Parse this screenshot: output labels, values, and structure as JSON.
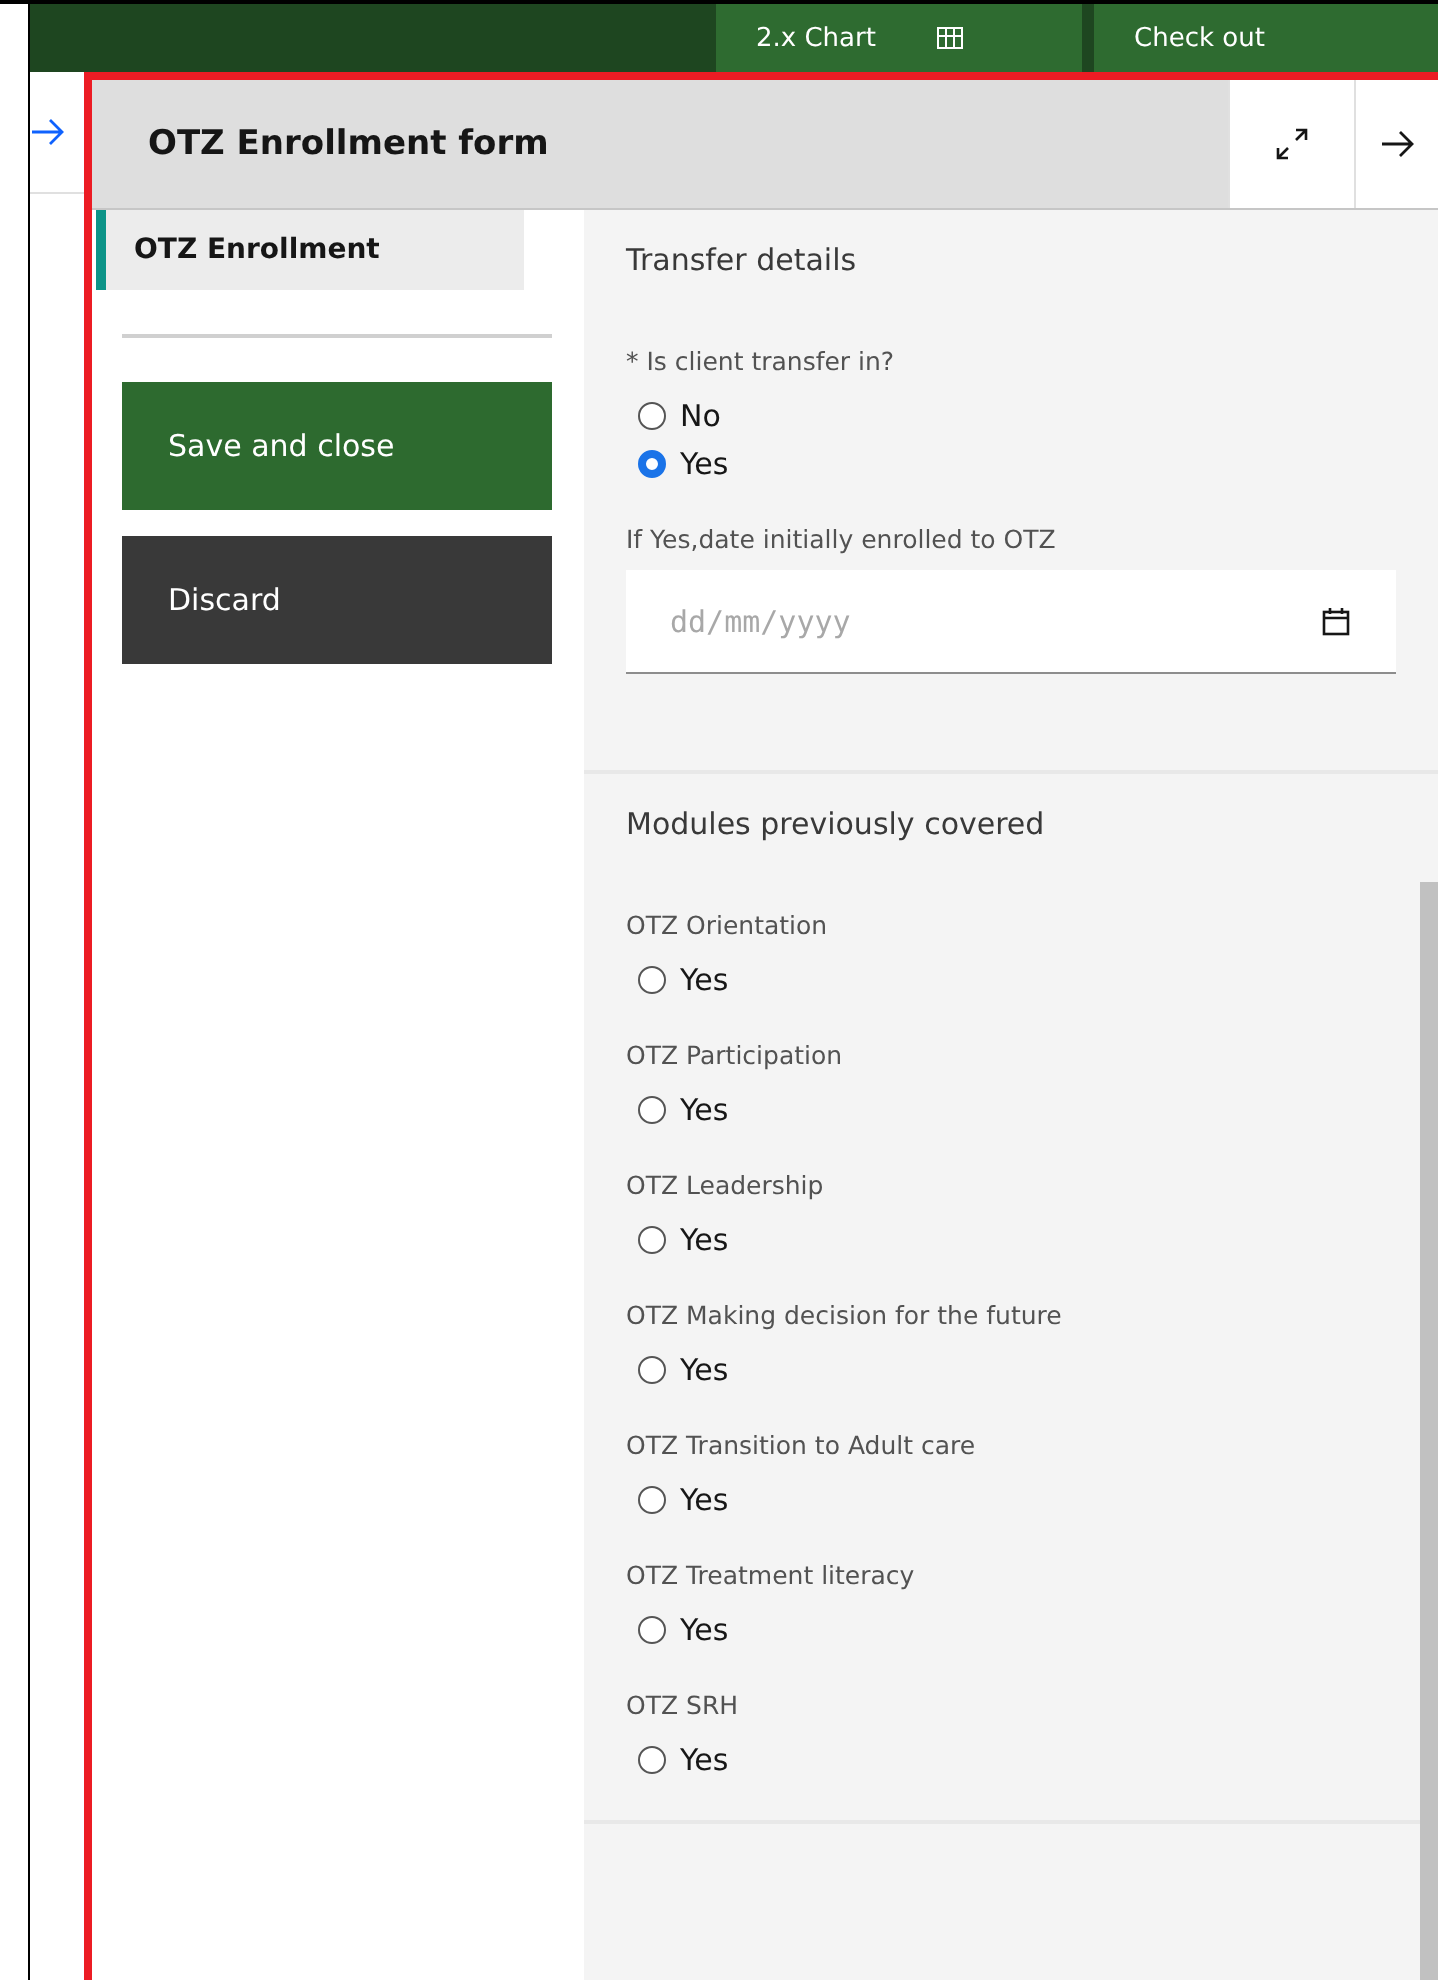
{
  "top_bar": {
    "buttons": [
      "2.x Chart",
      "Check out"
    ]
  },
  "panel": {
    "title": "OTZ Enrollment form"
  },
  "sidebar": {
    "tabs": [
      {
        "label": "OTZ Enrollment",
        "selected": true
      }
    ],
    "buttons": [
      {
        "label": "Save and close",
        "kind": "primary"
      },
      {
        "label": "Discard",
        "kind": "secondary"
      }
    ]
  },
  "sections": [
    {
      "title": "Transfer details",
      "fields": [
        {
          "kind": "radio",
          "label": "* Is client transfer in?",
          "options": [
            {
              "label": "No",
              "selected": false
            },
            {
              "label": "Yes",
              "selected": true
            }
          ]
        },
        {
          "kind": "date",
          "label": "If Yes,date initially enrolled to OTZ",
          "placeholder": "dd/mm/yyyy"
        }
      ]
    },
    {
      "title": "Modules previously covered",
      "fields": [
        {
          "kind": "radio",
          "label": "OTZ Orientation",
          "options": [
            {
              "label": "Yes",
              "selected": false
            }
          ]
        },
        {
          "kind": "radio",
          "label": "OTZ Participation",
          "options": [
            {
              "label": "Yes",
              "selected": false
            }
          ]
        },
        {
          "kind": "radio",
          "label": "OTZ Leadership",
          "options": [
            {
              "label": "Yes",
              "selected": false
            }
          ]
        },
        {
          "kind": "radio",
          "label": "OTZ Making decision for the future",
          "options": [
            {
              "label": "Yes",
              "selected": false
            }
          ]
        },
        {
          "kind": "radio",
          "label": "OTZ Transition to Adult care",
          "options": [
            {
              "label": "Yes",
              "selected": false
            }
          ]
        },
        {
          "kind": "radio",
          "label": "OTZ Treatment literacy",
          "options": [
            {
              "label": "Yes",
              "selected": false
            }
          ]
        },
        {
          "kind": "radio",
          "label": "OTZ SRH",
          "options": [
            {
              "label": "Yes",
              "selected": false
            }
          ]
        }
      ]
    }
  ]
}
